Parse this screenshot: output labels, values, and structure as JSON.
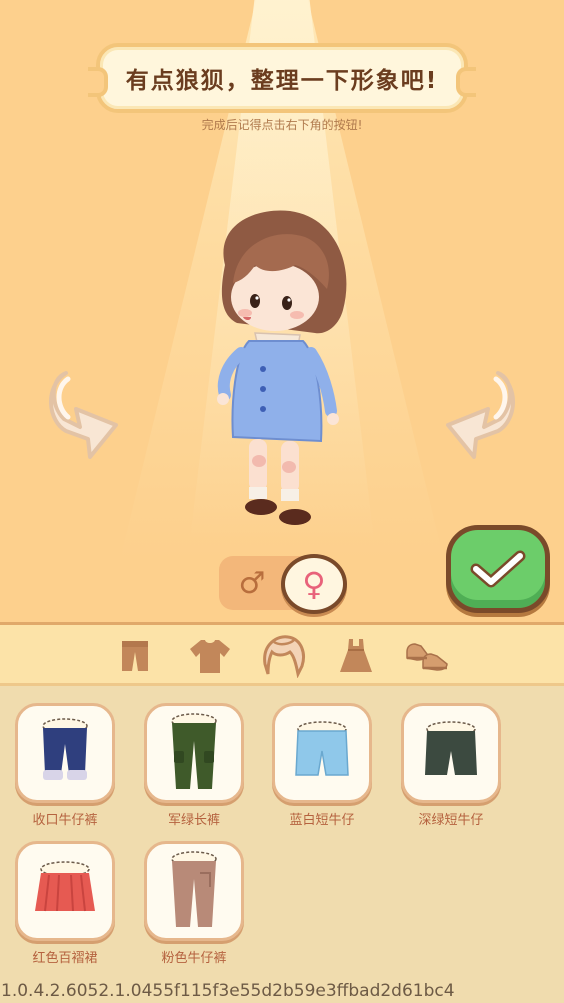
{
  "header": {
    "title": "有点狼狈，整理一下形象吧!",
    "subtitle": "完成后记得点击右下角的按钮!"
  },
  "gender": {
    "male_symbol": "♂",
    "female_symbol": "♀",
    "selected": "female"
  },
  "tabs": [
    {
      "name": "pants-tab",
      "icon": "pants-icon"
    },
    {
      "name": "shirt-tab",
      "icon": "shirt-icon"
    },
    {
      "name": "hair-tab",
      "icon": "hair-icon"
    },
    {
      "name": "dress-tab",
      "icon": "dress-icon"
    },
    {
      "name": "shoes-tab",
      "icon": "shoes-icon"
    }
  ],
  "items": [
    {
      "label": "收口牛仔裤",
      "color": "#2f3f7e"
    },
    {
      "label": "军绿长裤",
      "color": "#3f5a2a"
    },
    {
      "label": "蓝白短牛仔",
      "color": "#8fc8ea"
    },
    {
      "label": "深绿短牛仔",
      "color": "#3c4a40"
    },
    {
      "label": "红色百褶裙",
      "color": "#e65a52"
    },
    {
      "label": "粉色牛仔裤",
      "color": "#b88a78"
    }
  ],
  "version": "1.0.4.2.6052.1.0455f115f3e55d2b59e3ffbad2d61bc4",
  "colors": {
    "background": "#fdd08d",
    "confirm": "#6ccd6a",
    "panel": "#f0dcae"
  }
}
